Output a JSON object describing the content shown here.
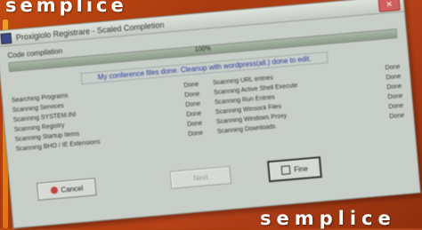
{
  "page": {
    "top_word": "semplice",
    "bottom_word": "semplice"
  },
  "window": {
    "title": "Proxigiolo Registrare - Scaled Completion",
    "progress_label": "Code compilation",
    "progress_percent": 100,
    "progress_text": "100%",
    "status_message": "My conference files done. Cleanup with wordpress(all.) done to edit.",
    "left_items": [
      {
        "name": "Searching Programs",
        "status": "Done"
      },
      {
        "name": "Scanning Services",
        "status": "Done"
      },
      {
        "name": "Scanning SYSTEM.INI",
        "status": "Done"
      },
      {
        "name": "Scanning Registry",
        "status": "Done"
      },
      {
        "name": "Scanning Startup Items",
        "status": "Done"
      },
      {
        "name": "Scanning BHO / IE Extensions",
        "status": "Done"
      }
    ],
    "right_items": [
      {
        "name": "Scanning URL entries",
        "status": "Done"
      },
      {
        "name": "Scanning Active Shell Execute",
        "status": "Done"
      },
      {
        "name": "Scanning Run Entries",
        "status": "Done"
      },
      {
        "name": "Scanning Winsock Files",
        "status": "Done"
      },
      {
        "name": "Scanning Windows Proxy",
        "status": "Done"
      },
      {
        "name": "Scanning Downloads",
        "status": "Done"
      }
    ],
    "buttons": {
      "cancel": "Cancel",
      "next": "Next",
      "finish": "Fine"
    }
  },
  "colors": {
    "background": "#b8421a",
    "accent_bar": "#f0a020",
    "window": "#c8cec8"
  }
}
